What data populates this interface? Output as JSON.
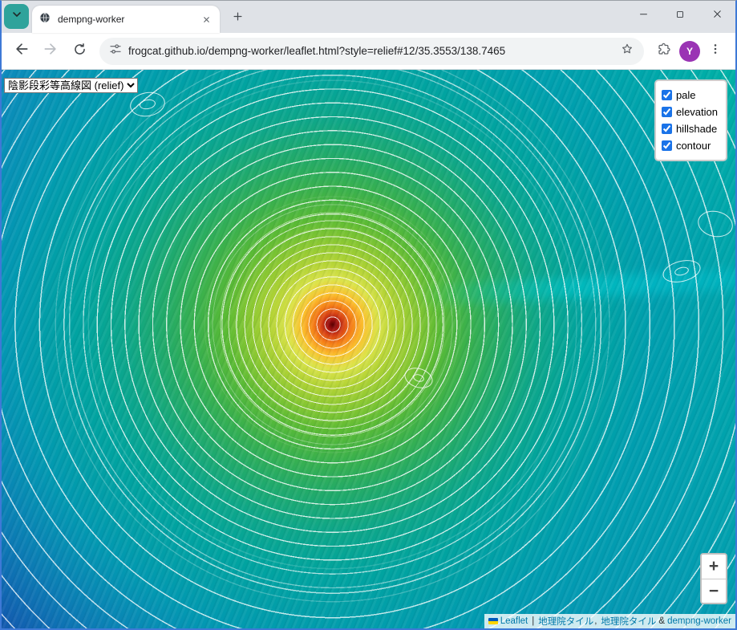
{
  "window": {
    "tab_title": "dempng-worker"
  },
  "address_bar": {
    "url": "frogcat.github.io/dempng-worker/leaflet.html?style=relief#12/35.3553/138.7465",
    "avatar_letter": "Y"
  },
  "map_ui": {
    "style_selector": {
      "selected": "陰影段彩等高線図 (relief)"
    },
    "layers_panel": {
      "items": [
        {
          "label": "pale",
          "checked": true
        },
        {
          "label": "elevation",
          "checked": true
        },
        {
          "label": "hillshade",
          "checked": true
        },
        {
          "label": "contour",
          "checked": true
        }
      ]
    },
    "zoom_control": {
      "zoom_in": "+",
      "zoom_out": "−"
    },
    "attribution": {
      "leaflet_link": "Leaflet",
      "separator": "|",
      "tile_link_1": "地理院タイル",
      "comma": ",",
      "tile_link_2": "地理院タイル",
      "ampersand": "&",
      "worker_link": "dempng-worker"
    }
  },
  "colors": {
    "window_frame": "#3e79d6",
    "tab_search_teal": "#2fa39b",
    "avatar_purple": "#9a34b4",
    "checkbox_accent": "#1a73e8",
    "attribution_link": "#0078a8",
    "map_summit_red": "#a01010",
    "map_mid_green": "#5cbb34",
    "map_outer_blue": "#1550ae"
  }
}
